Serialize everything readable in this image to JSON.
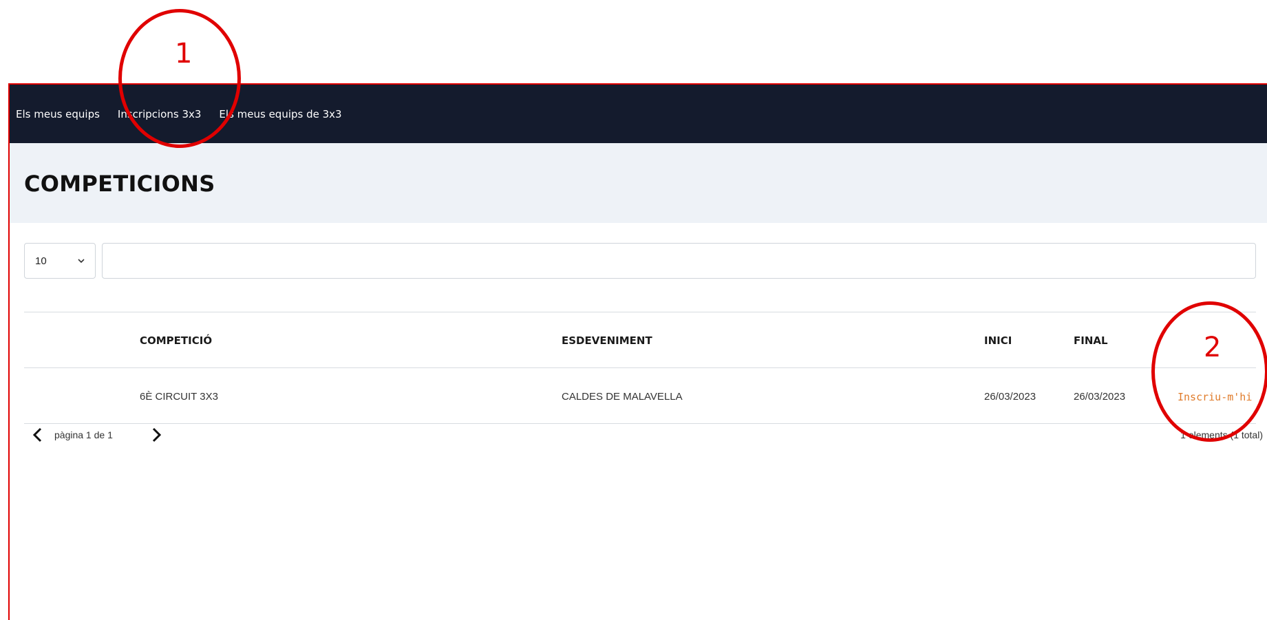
{
  "nav": {
    "items": [
      {
        "label": "Els meus equips"
      },
      {
        "label": "Inscripcions 3x3"
      },
      {
        "label": "Els meus equips de 3x3"
      }
    ]
  },
  "page": {
    "title": "COMPETICIONS"
  },
  "controls": {
    "page_size": "10",
    "search_value": "",
    "search_placeholder": ""
  },
  "table": {
    "columns": [
      "COMPETICIÓ",
      "ESDEVENIMENT",
      "INICI",
      "FINAL"
    ],
    "rows": [
      {
        "competition": "6È CIRCUIT 3X3",
        "event": "CALDES DE MALAVELLA",
        "start": "26/03/2023",
        "end": "26/03/2023",
        "action": "Inscriu-m'hi"
      }
    ]
  },
  "pager": {
    "page_text": "pàgina 1 de 1",
    "count_text": "1 elements (1 total)"
  },
  "annotations": [
    {
      "label": "1"
    },
    {
      "label": "2"
    }
  ],
  "colors": {
    "nav_bg": "#141b2d",
    "header_bg": "#eef2f7",
    "action_link": "#e07b2a",
    "annotation": "#e00000"
  },
  "icons": {
    "select_arrow": "chevron-down-icon",
    "prev": "chevron-left-icon",
    "next": "chevron-right-icon"
  }
}
